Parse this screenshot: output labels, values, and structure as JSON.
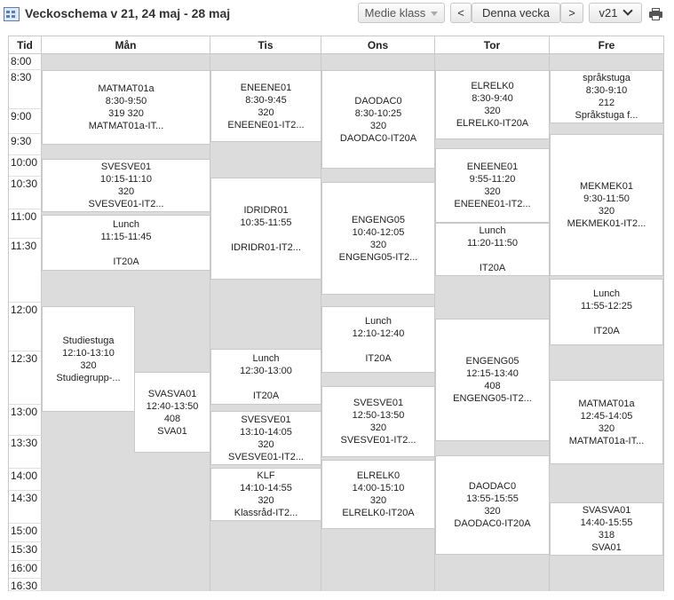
{
  "header": {
    "title": "Veckoschema v 21, 24 maj - 28 maj",
    "class_select": "Medie klass",
    "prev": "<",
    "current_week": "Denna vecka",
    "next": ">",
    "week_select": "v21"
  },
  "columns": {
    "time": "Tid",
    "mon": "Mån",
    "tue": "Tis",
    "wed": "Ons",
    "thu": "Tor",
    "fri": "Fre"
  },
  "times": [
    "8:00",
    "8:30",
    "9:00",
    "9:30",
    "10:00",
    "10:30",
    "11:00",
    "11:30",
    "12:00",
    "12:30",
    "13:00",
    "13:30",
    "14:00",
    "14:30",
    "15:00",
    "15:30",
    "16:00",
    "16:30"
  ],
  "lessons": {
    "mon": [
      [
        "MATMAT01a",
        "8:30-9:50",
        "319 320",
        "MATMAT01a-IT..."
      ],
      [
        "SVESVE01",
        "10:15-11:10",
        "320",
        "SVESVE01-IT2..."
      ],
      [
        "Lunch",
        "11:15-11:45",
        "",
        "IT20A"
      ],
      [
        "Studiestuga",
        "12:10-13:10",
        "320",
        "Studiegrupp-..."
      ],
      [
        "SVASVA01",
        "12:40-13:50",
        "408",
        "SVA01"
      ]
    ],
    "tue": [
      [
        "ENEENE01",
        "8:30-9:45",
        "320",
        "ENEENE01-IT2..."
      ],
      [
        "IDRIDR01",
        "10:35-11:55",
        "",
        "IDRIDR01-IT2..."
      ],
      [
        "Lunch",
        "12:30-13:00",
        "",
        "IT20A"
      ],
      [
        "SVESVE01",
        "13:10-14:05",
        "320",
        "SVESVE01-IT2..."
      ],
      [
        "KLF",
        "14:10-14:55",
        "320",
        "Klassråd-IT2..."
      ]
    ],
    "wed": [
      [
        "DAODAC0",
        "8:30-10:25",
        "320",
        "DAODAC0-IT20A"
      ],
      [
        "ENGENG05",
        "10:40-12:05",
        "320",
        "ENGENG05-IT2..."
      ],
      [
        "Lunch",
        "12:10-12:40",
        "",
        "IT20A"
      ],
      [
        "SVESVE01",
        "12:50-13:50",
        "320",
        "SVESVE01-IT2..."
      ],
      [
        "ELRELK0",
        "14:00-15:10",
        "320",
        "ELRELK0-IT20A"
      ]
    ],
    "thu": [
      [
        "ELRELK0",
        "8:30-9:40",
        "320",
        "ELRELK0-IT20A"
      ],
      [
        "ENEENE01",
        "9:55-11:20",
        "320",
        "ENEENE01-IT2..."
      ],
      [
        "Lunch",
        "11:20-11:50",
        "",
        "IT20A"
      ],
      [
        "ENGENG05",
        "12:15-13:40",
        "408",
        "ENGENG05-IT2..."
      ],
      [
        "DAODAC0",
        "13:55-15:55",
        "320",
        "DAODAC0-IT20A"
      ]
    ],
    "fri": [
      [
        "språkstuga",
        "8:30-9:10",
        "212",
        "Språkstuga f..."
      ],
      [
        "MEKMEK01",
        "9:30-11:50",
        "320",
        "MEKMEK01-IT2..."
      ],
      [
        "Lunch",
        "11:55-12:25",
        "",
        "IT20A"
      ],
      [
        "MATMAT01a",
        "12:45-14:05",
        "320",
        "MATMAT01a-IT..."
      ],
      [
        "SVASVA01",
        "14:40-15:55",
        "318",
        "SVA01"
      ]
    ]
  }
}
